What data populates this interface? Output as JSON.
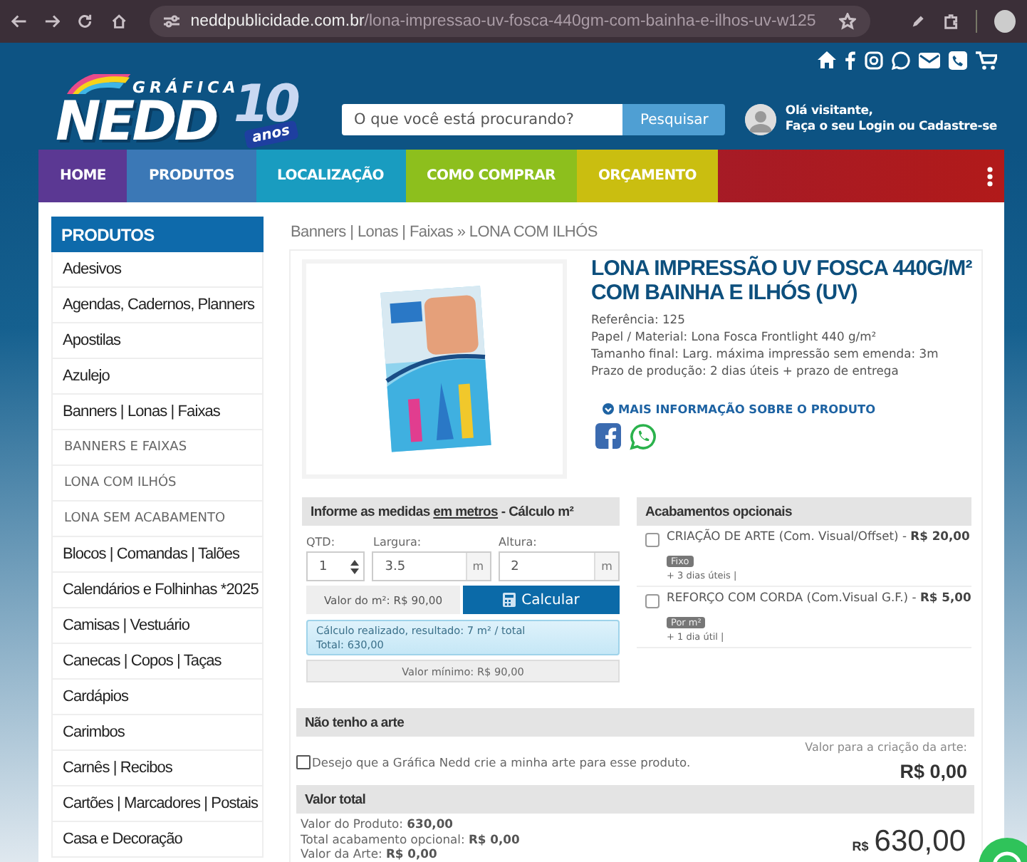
{
  "browser": {
    "url_host": "neddpublicidade.com.br",
    "url_path": "/lona-impressao-uv-fosca-440gm-com-bainha-e-ilhos-uv-w125"
  },
  "header": {
    "logo": {
      "small": "GRÁFICA",
      "big": "NEDD",
      "badge_number": "10",
      "badge_word": "anos"
    },
    "search": {
      "placeholder": "O que você está procurando?",
      "button": "Pesquisar"
    },
    "user": {
      "greeting": "Olá visitante,",
      "prompt": "Faça o seu",
      "login": "Login",
      "joiner": "ou",
      "signup": "Cadastre-se"
    }
  },
  "nav": [
    {
      "label": "HOME",
      "color": "#5b3893"
    },
    {
      "label": "PRODUTOS",
      "color": "#3b78b6"
    },
    {
      "label": "LOCALIZAÇÃO",
      "color": "#199cc0"
    },
    {
      "label": "COMO COMPRAR",
      "color": "#8dbf1d"
    },
    {
      "label": "ORÇAMENTO",
      "color": "#cabe10"
    }
  ],
  "sidebar": {
    "title": "PRODUTOS",
    "items": [
      {
        "label": "Adesivos"
      },
      {
        "label": "Agendas, Cadernos, Planners"
      },
      {
        "label": "Apostilas"
      },
      {
        "label": "Azulejo"
      },
      {
        "label": "Banners | Lonas | Faixas",
        "children": [
          {
            "label": "BANNERS E FAIXAS"
          },
          {
            "label": "LONA COM ILHÓS"
          },
          {
            "label": "LONA SEM ACABAMENTO"
          }
        ]
      },
      {
        "label": "Blocos | Comandas | Talões"
      },
      {
        "label": "Calendários e Folhinhas *2025"
      },
      {
        "label": "Camisas | Vestuário"
      },
      {
        "label": "Canecas | Copos | Taças"
      },
      {
        "label": "Cardápios"
      },
      {
        "label": "Carimbos"
      },
      {
        "label": "Carnês | Recibos"
      },
      {
        "label": "Cartões | Marcadores | Postais"
      },
      {
        "label": "Casa e Decoração"
      }
    ]
  },
  "breadcrumb": {
    "parent": "Banners | Lonas | Faixas",
    "separator": "»",
    "current": "LONA COM ILHÓS"
  },
  "product": {
    "title": "LONA IMPRESSÃO UV FOSCA 440G/M² COM BAINHA E ILHÓS (UV)",
    "specs": [
      "Referência: 125",
      "Papel / Material: Lona Fosca Frontlight 440 g/m²",
      "Tamanho final: Larg. máxima impressão sem emenda: 3m",
      "Prazo de produção: 2 dias úteis + prazo de entrega"
    ],
    "more_info": "MAIS INFORMAÇÃO SOBRE O PRODUTO"
  },
  "calculator": {
    "title_before": "Informe as medidas",
    "title_link": "em metros",
    "title_after": "- Cálculo m²",
    "quantity": {
      "label": "QTD:",
      "value": "1"
    },
    "width": {
      "label": "Largura:",
      "value": "3.5",
      "unit": "m"
    },
    "height": {
      "label": "Altura:",
      "value": "2",
      "unit": "m"
    },
    "price_per_m2": "Valor do m²: R$ 90,00",
    "button": "Calcular",
    "result": [
      "Cálculo realizado, resultado: 7 m² / total",
      "Total: 630,00"
    ],
    "minimum": "Valor mínimo: R$ 90,00"
  },
  "finishing": {
    "title": "Acabamentos opcionais",
    "options": [
      {
        "name": "CRIAÇÃO DE ARTE (Com. Visual/Offset) - **R$ 20,00**",
        "tag": "Fixo",
        "note": "+ 3 dias úteis |",
        "checked": false
      },
      {
        "name": "REFORÇO COM CORDA (Com.Visual G.F.) - **R$ 5,00**",
        "tag": "Por m²",
        "note": "+ 1 dia útil |",
        "checked": false
      }
    ]
  },
  "art": {
    "title": "Não tenho a arte",
    "checkbox_label": "Desejo que a Gráfica Nedd crie a minha arte para esse produto.",
    "checked": false,
    "price_label": "Valor para a criação da arte:",
    "price": "R$ 0,00"
  },
  "total": {
    "title": "Valor total",
    "lines": [
      "Valor do Produto: **630,00**",
      "Total acabamento opcional: **R$ 0,00**",
      "Valor da Arte: **R$ 0,00**"
    ],
    "currency": "R$",
    "amount": "630,00"
  }
}
